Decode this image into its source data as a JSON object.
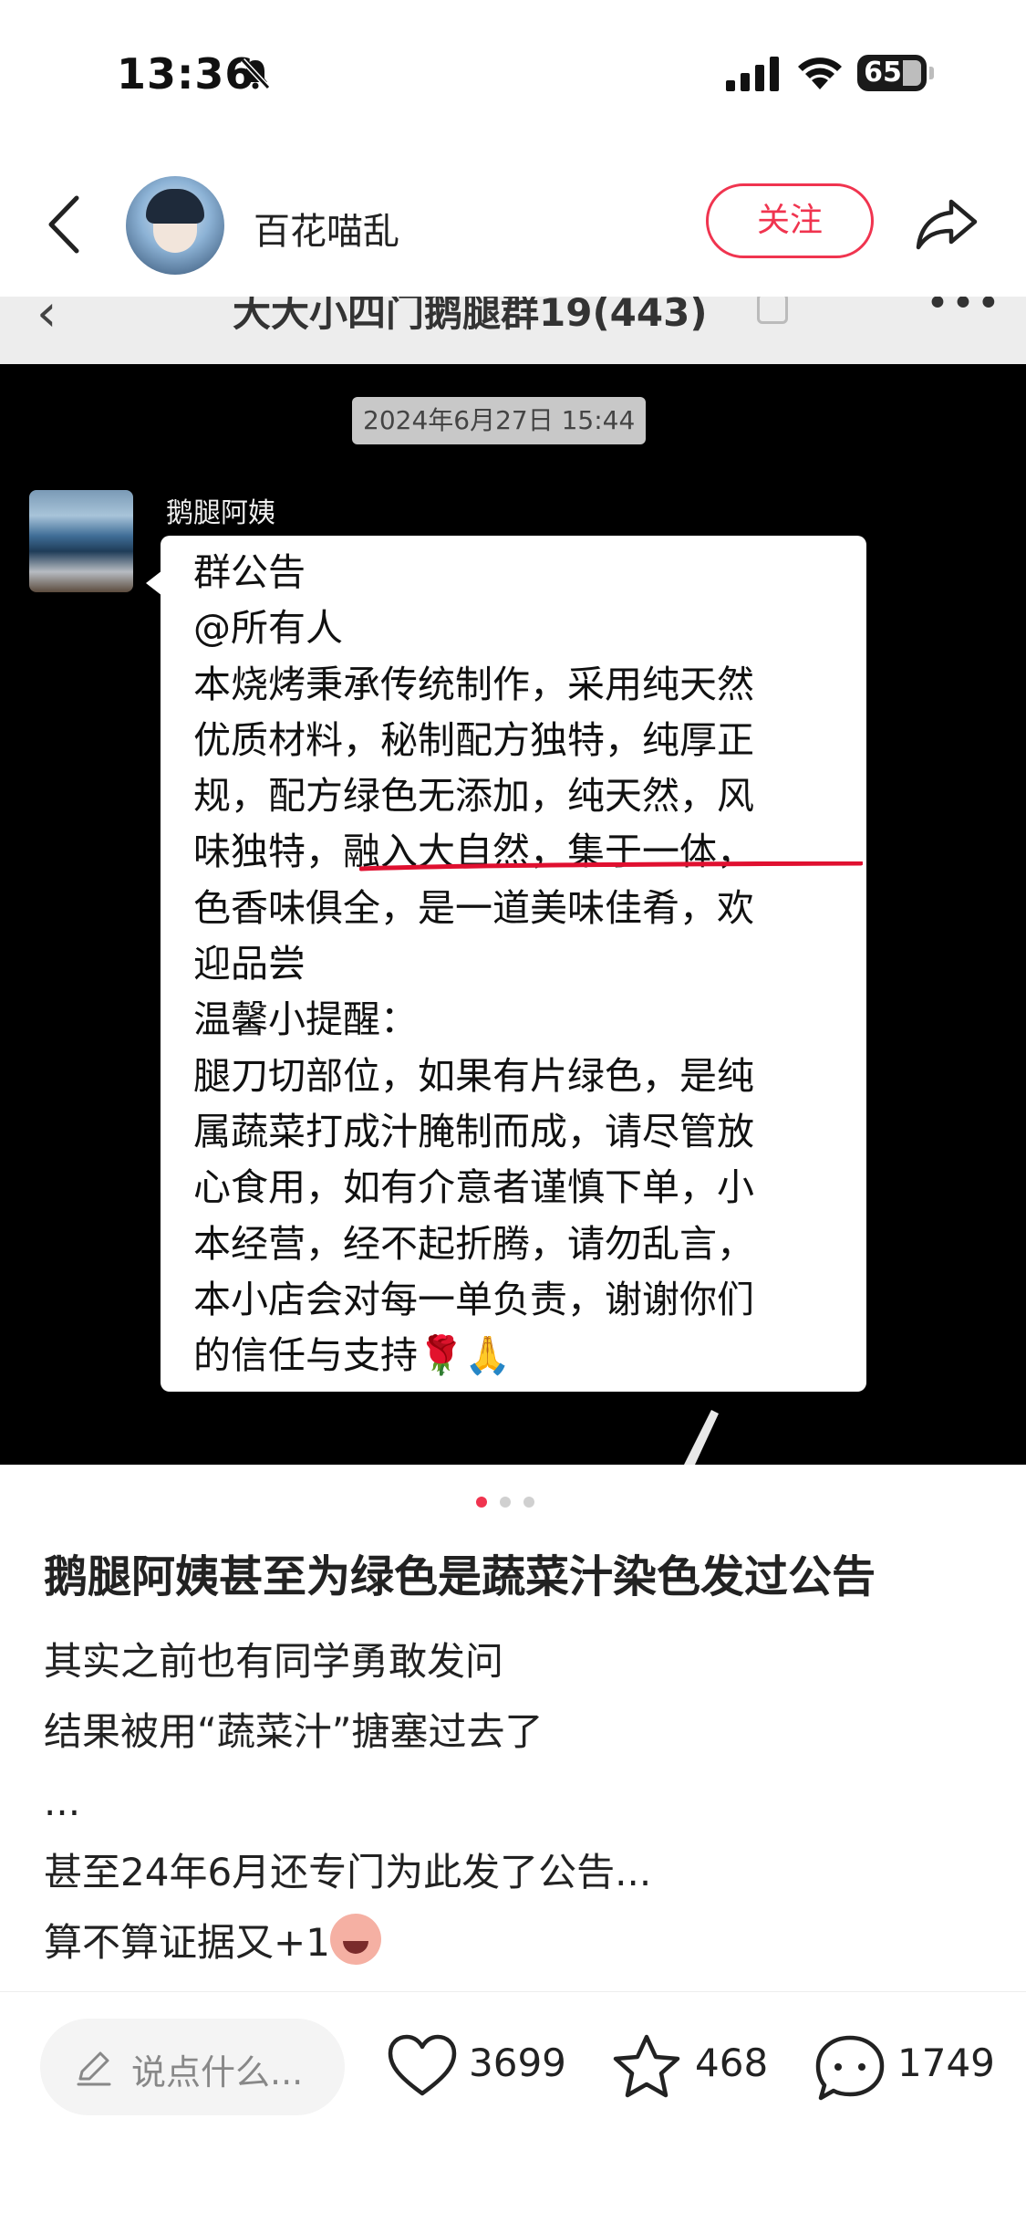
{
  "status_bar": {
    "time": "13:36",
    "battery": "65"
  },
  "header": {
    "author": "百花喵乱",
    "follow_label": "关注"
  },
  "image": {
    "chat_title": "大大小四门鹅腿群19(443)",
    "date": "2024年6月27日 15:44",
    "sender": "鹅腿阿姨",
    "message_lines": [
      "群公告",
      "@所有人",
      "本烧烤秉承传统制作，采用纯天然",
      "优质材料，秘制配方独特，纯厚正",
      "规，配方绿色无添加，纯天然，风",
      "味独特，融入大自然，集于一体，",
      "色香味俱全，是一道美味佳肴，欢",
      "迎品尝",
      "温馨小提醒：",
      "腿刀切部位，如果有片绿色，是纯",
      "属蔬菜打成汁腌制而成，请尽管放",
      "心食用，如有介意者谨慎下单，小",
      "本经营，经不起折腾，请勿乱言，",
      "本小店会对每一单负责，谢谢你们",
      "的信任与支持"
    ],
    "message_emojis": "🌹🙏"
  },
  "carousel": {
    "pages": 3,
    "active": 1
  },
  "post": {
    "title": "鹅腿阿姨甚至为绿色是蔬菜汁染色发过公告",
    "lines": [
      "其实之前也有同学勇敢发问",
      "结果被用“蔬菜汁”搪塞过去了",
      "...",
      "甚至24年6月还专门为此发了公告..."
    ],
    "last_line": "算不算证据又+1"
  },
  "bottom_bar": {
    "comment_placeholder": "说点什么...",
    "likes": "3699",
    "collects": "468",
    "comments": "1749"
  },
  "colors": {
    "accent": "#f0344f",
    "underline": "#e01030"
  }
}
